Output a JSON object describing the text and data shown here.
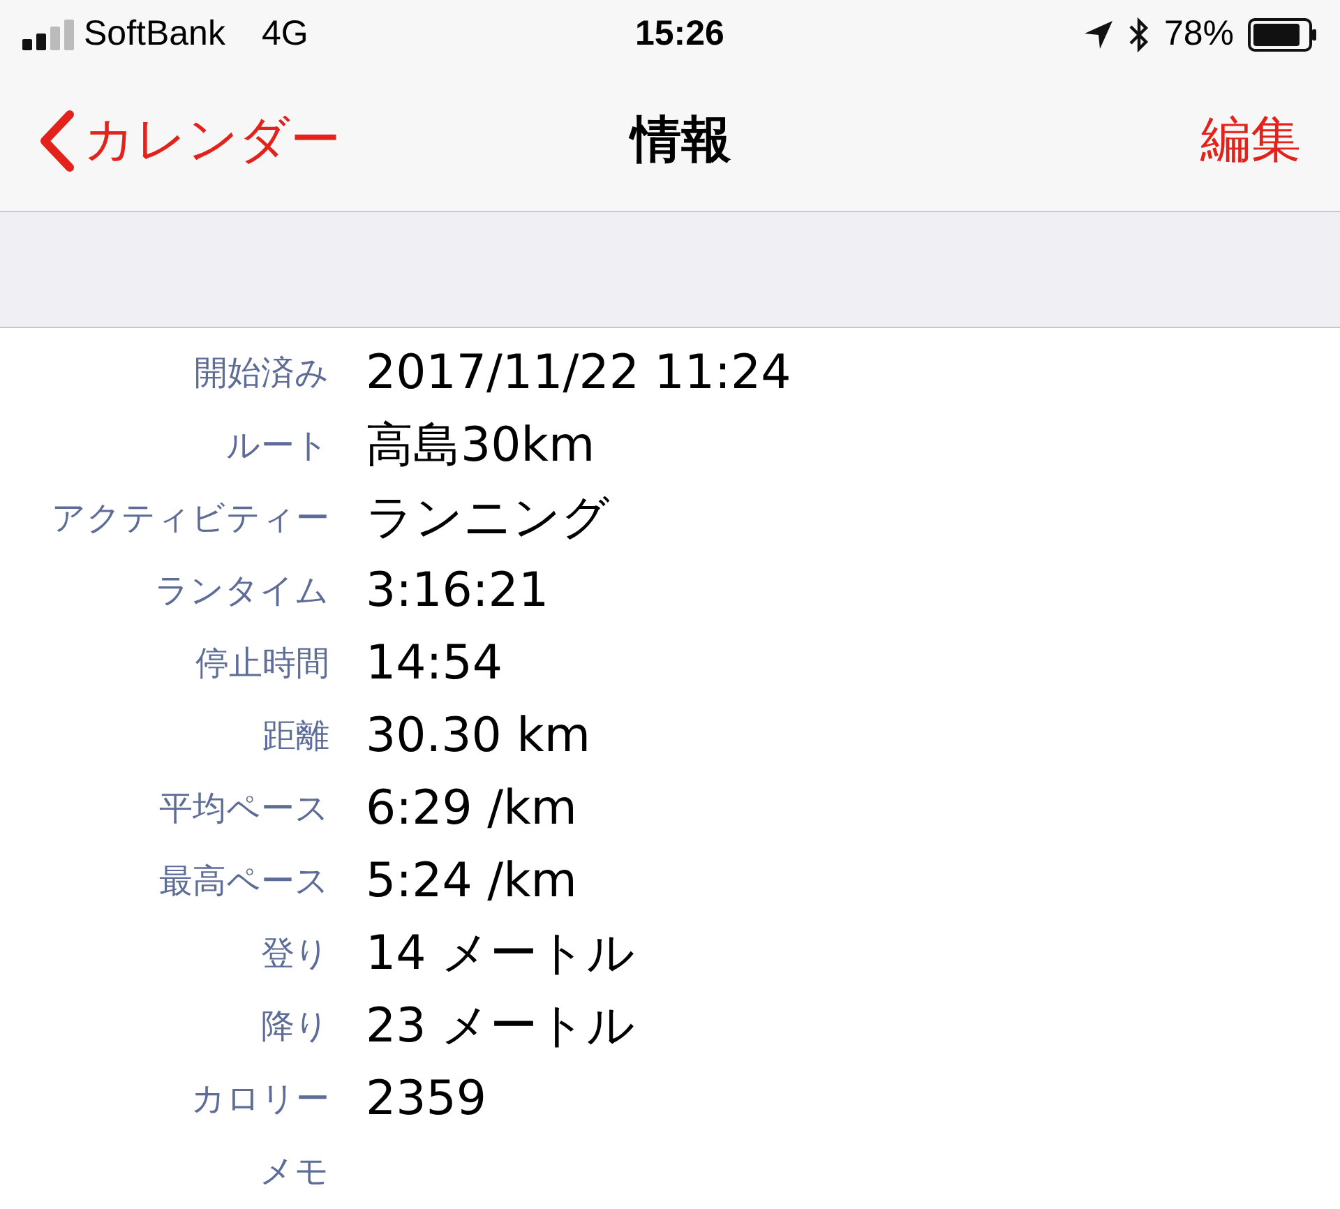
{
  "status_bar": {
    "carrier": "SoftBank",
    "network": "4G",
    "time": "15:26",
    "battery": "78%"
  },
  "nav": {
    "back": "カレンダー",
    "title": "情報",
    "action": "編集"
  },
  "rows": [
    {
      "label": "開始済み",
      "value": "2017/11/22 11:24"
    },
    {
      "label": "ルート",
      "value": "高島30km"
    },
    {
      "label": "アクティビティー",
      "value": "ランニング"
    },
    {
      "label": "ランタイム",
      "value": "3:16:21"
    },
    {
      "label": "停止時間",
      "value": "14:54"
    },
    {
      "label": "距離",
      "value": "30.30 km"
    },
    {
      "label": "平均ペース",
      "value": "6:29 /km"
    },
    {
      "label": "最高ペース",
      "value": "5:24 /km"
    },
    {
      "label": "登り",
      "value": "14 メートル"
    },
    {
      "label": "降り",
      "value": "23 メートル"
    },
    {
      "label": "カロリー",
      "value": "2359"
    },
    {
      "label": "メモ"
    }
  ]
}
